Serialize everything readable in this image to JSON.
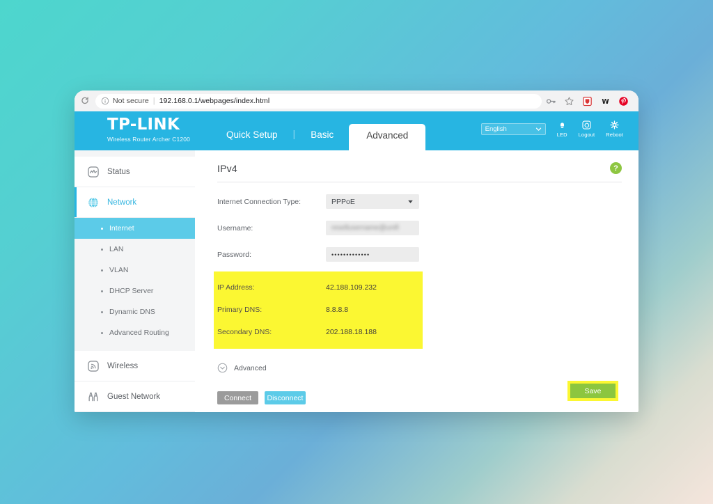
{
  "browser": {
    "security_label": "Not secure",
    "url": "192.168.0.1/webpages/index.html",
    "icons": [
      "reload-icon",
      "info-icon",
      "key-icon",
      "star-icon",
      "honey-extension-icon",
      "wikipedia-extension-icon",
      "pinterest-extension-icon"
    ]
  },
  "header": {
    "brand_name": "TP-LINK",
    "brand_sub": "Wireless Router Archer C1200",
    "tabs": [
      {
        "label": "Quick Setup",
        "active": false
      },
      {
        "label": "Basic",
        "active": false
      },
      {
        "label": "Advanced",
        "active": true
      }
    ],
    "language": "English",
    "actions": [
      {
        "label": "LED",
        "icon": "led-icon"
      },
      {
        "label": "Logout",
        "icon": "logout-icon"
      },
      {
        "label": "Reboot",
        "icon": "reboot-icon"
      }
    ]
  },
  "sidebar": {
    "groups": [
      {
        "label": "Status",
        "icon": "status-icon",
        "active": false,
        "children": []
      },
      {
        "label": "Network",
        "icon": "network-globe-icon",
        "active": true,
        "children": [
          {
            "label": "Internet",
            "active": true
          },
          {
            "label": "LAN",
            "active": false
          },
          {
            "label": "VLAN",
            "active": false
          },
          {
            "label": "DHCP Server",
            "active": false
          },
          {
            "label": "Dynamic DNS",
            "active": false
          },
          {
            "label": "Advanced Routing",
            "active": false
          }
        ]
      },
      {
        "label": "Wireless",
        "icon": "wireless-icon",
        "active": false,
        "children": []
      },
      {
        "label": "Guest Network",
        "icon": "guest-network-icon",
        "active": false,
        "children": []
      }
    ]
  },
  "content": {
    "panel_title": "IPv4",
    "help_label": "?",
    "fields": [
      {
        "label": "Internet Connection Type:",
        "value": "PPPoE",
        "type": "select"
      },
      {
        "label": "Username:",
        "value": "resellusername@unifi",
        "type": "blurred-text"
      },
      {
        "label": "Password:",
        "value": "•••••••••••••",
        "type": "password"
      }
    ],
    "status_rows": [
      {
        "label": "IP Address:",
        "value": "42.188.109.232"
      },
      {
        "label": "Primary DNS:",
        "value": "8.8.8.8"
      },
      {
        "label": "Secondary DNS:",
        "value": "202.188.18.188"
      }
    ],
    "advanced_label": "Advanced",
    "connect_label": "Connect",
    "disconnect_label": "Disconnect",
    "save_label": "Save"
  },
  "colors": {
    "brand_blue": "#27b5e2",
    "active_sub_blue": "#5ccbe8",
    "highlight_yellow": "#fbf732",
    "save_green": "#8cc63f",
    "help_green": "#8ec641"
  }
}
